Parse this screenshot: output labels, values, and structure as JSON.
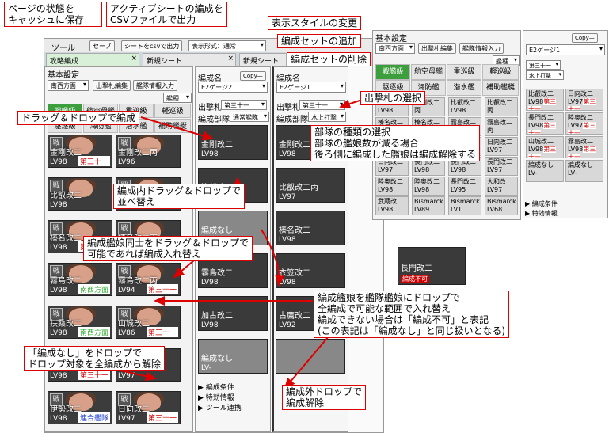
{
  "callouts": {
    "save": "ページの状態を\nキャッシュに保存",
    "csv": "アクティブシートの編成を\nCSVファイルで出力",
    "style": "表示スタイルの変更",
    "add_set": "編成セットの追加",
    "del_set": "編成セットの削除",
    "select_fleet": "出撃札の選択",
    "drag_form": "ドラッグ＆ドロップで編成",
    "type_select": "部隊の種類の選択\n部隊の艦娘数が減る場合\n後ろ側に編成した艦娘は編成解除する",
    "reorder": "編成内ドラッグ＆ドロップで\n並べ替え",
    "swap": "編成艦娘同士をドラッグ＆ドロップで\n可能であれば編成入れ替え",
    "drop_on": "編成艦娘を艦隊艦娘にドロップで\n全編成で可能な範囲で入れ替え\n編成できない場合は「編成不可」と表記\n(この表記は「編成なし」と同じ扱いとなる)",
    "drop_none": "「編成なし」をドロップで\nドロップ対象を全編成から解除",
    "drop_out": "編成外ドロップで\n編成解除"
  },
  "toolbar": {
    "tool": "ツール",
    "save": "セーブ",
    "csv": "シートをcsvで出力",
    "style": "表示形式：通常"
  },
  "tabs": [
    "攻略編成",
    "新規シート",
    "新規シート"
  ],
  "left": {
    "title": "基本設定",
    "area": "南西方面",
    "fleet_edit": "出撃札編集",
    "import": "艦隊情報入力",
    "filter": "艦種",
    "types": [
      "戦艦級",
      "航空母艦",
      "重巡級",
      "軽巡級",
      "駆逐級",
      "海防艦",
      "潜水艦",
      "補助艦艇"
    ],
    "ships": [
      {
        "name": "金剛改二",
        "lv": "LV98",
        "tag": "第三十一"
      },
      {
        "name": "金剛改二丙",
        "lv": "LV96",
        "tag": ""
      },
      {
        "name": "比叡改二",
        "lv": "LV98",
        "tag": ""
      },
      {
        "name": "比叡改二丙",
        "lv": "LV97",
        "tag": ""
      },
      {
        "name": "榛名改二",
        "lv": "LV98",
        "tag": "第三十一"
      },
      {
        "name": "榛名改二丙",
        "lv": "LV97",
        "tag": ""
      },
      {
        "name": "霧島改二",
        "lv": "LV98",
        "tag": "南西方面"
      },
      {
        "name": "霧島改二丙",
        "lv": "LV94",
        "tag": "第三十一"
      },
      {
        "name": "扶桑改二",
        "lv": "LV98",
        "tag": "南西方面"
      },
      {
        "name": "山城改二",
        "lv": "LV86",
        "tag": "第三十一"
      },
      {
        "name": "伊勢改二",
        "lv": "LV98",
        "tag": "第三十一"
      },
      {
        "name": "日向改二",
        "lv": "LV97",
        "tag": ""
      },
      {
        "name": "伊勢改二",
        "lv": "LV98",
        "tag": "連合艦隊"
      },
      {
        "name": "日向改二",
        "lv": "LV97",
        "tag": "第三十一"
      }
    ]
  },
  "sets": [
    {
      "label": "編成名",
      "copy": "Copy—",
      "name": "E2ゲージ2",
      "fleet": "第三十一",
      "kind": "通常艦隊",
      "fleet_label": "出撃札",
      "kind_label": "編成部隊",
      "slots": [
        {
          "name": "金剛改二",
          "lv": "LV98"
        },
        {
          "name": "比叡改二",
          "lv": "LV98"
        },
        {
          "name": "編成なし",
          "lv": "LV-"
        },
        {
          "name": "霧島改二",
          "lv": "LV98"
        },
        {
          "name": "加古改二",
          "lv": "LV98"
        },
        {
          "name": "編成なし",
          "lv": "LV-"
        }
      ],
      "menu": [
        "編成条件",
        "特効情報",
        "ツール連携"
      ]
    },
    {
      "label": "編成名",
      "copy": "Copy—",
      "name": "E2ゲージ1",
      "fleet": "第三十一",
      "kind": "水上打撃",
      "fleet_label": "出撃札",
      "kind_label": "編成部隊",
      "slots": [
        {
          "name": "金剛改二",
          "lv": "LV98"
        },
        {
          "name": "比叡改二丙",
          "lv": "LV97"
        },
        {
          "name": "榛名改二",
          "lv": "LV98"
        },
        {
          "name": "衣笠改二",
          "lv": "LV98"
        },
        {
          "name": "古鷹改二",
          "lv": "LV92"
        },
        {
          "name": "",
          "lv": ""
        }
      ]
    }
  ],
  "right": {
    "title": "基本設定",
    "area": "南西方面",
    "fleet_edit": "出撃札編集",
    "import": "艦隊情報入力",
    "filter": "艦種",
    "types": [
      "戦艦級",
      "航空母艦",
      "重巡級",
      "軽巡級",
      "駆逐級",
      "海防艦",
      "潜水艦",
      "補助艦艇"
    ],
    "minis": [
      {
        "n": "金剛改二",
        "l": "LV98"
      },
      {
        "n": "金剛改二丙",
        "l": "LV96"
      },
      {
        "n": "比叡改二",
        "l": "LV98"
      },
      {
        "n": "比叡改二丙",
        "l": "LV97"
      },
      {
        "n": "榛名改二",
        "l": "LV98"
      },
      {
        "n": "榛名改二丙",
        "l": "LV97"
      },
      {
        "n": "霧島改二",
        "l": "LV98"
      },
      {
        "n": "霧島改二丙",
        "l": "LV94"
      },
      {
        "n": "扶桑改二",
        "l": "LV98"
      },
      {
        "n": "山城改二",
        "l": "LV86"
      },
      {
        "n": "伊勢改二",
        "l": "LV98"
      },
      {
        "n": "日向改二",
        "l": "LV97"
      },
      {
        "n": "日向改二",
        "l": "LV97"
      },
      {
        "n": "長門改二",
        "l": "LV98"
      },
      {
        "n": "長門改二",
        "l": "LV98"
      },
      {
        "n": "長門改二",
        "l": "LV97"
      },
      {
        "n": "陸奥改二",
        "l": "LV98"
      },
      {
        "n": "陸奥改二",
        "l": "LV98"
      },
      {
        "n": "長門改二",
        "l": "LV95"
      },
      {
        "n": "大和改",
        "l": "LV97"
      },
      {
        "n": "武蔵改二",
        "l": "LV98"
      },
      {
        "n": "Bismarck",
        "l": "LV89"
      },
      {
        "n": "Bismarck",
        "l": "LV1"
      },
      {
        "n": "Bismarck",
        "l": "LV68"
      }
    ],
    "preview_name": "長門改二",
    "preview_badge": "編成不可"
  },
  "far": {
    "copy": "Copy—",
    "name": "E2ゲージ1",
    "fleet": "第三十一",
    "kind": "水上打撃",
    "ships": [
      {
        "n": "比叡改二",
        "l": "LV98",
        "t": "第三十一"
      },
      {
        "n": "日向改二",
        "l": "LV97",
        "t": "第三十一"
      },
      {
        "n": "長門改二",
        "l": "LV98",
        "t": "第三十一"
      },
      {
        "n": "陸奥改二",
        "l": "LV97",
        "t": "第三十一"
      },
      {
        "n": "山城改二",
        "l": "LV98",
        "t": "第三十一"
      },
      {
        "n": "霧島改二",
        "l": "LV98",
        "t": "第三十一"
      },
      {
        "n": "編成なし",
        "l": "LV-",
        "t": ""
      },
      {
        "n": "編成なし",
        "l": "LV-",
        "t": ""
      }
    ],
    "menu": [
      "編成条件",
      "特効情報"
    ]
  },
  "colors": {
    "accent": "#3d9e3d",
    "callout_border": "#d00000",
    "tag": "#cc0000"
  }
}
